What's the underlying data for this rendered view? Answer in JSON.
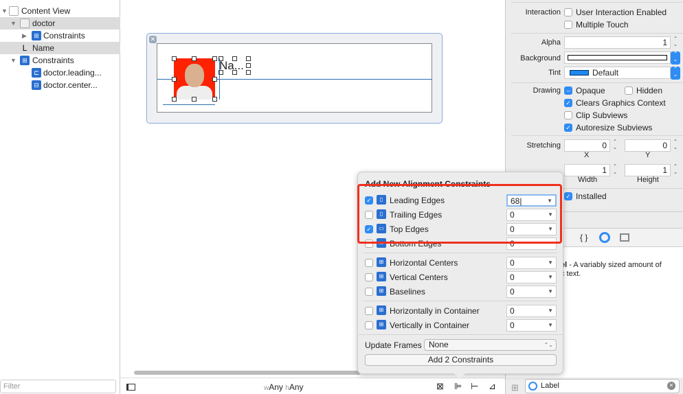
{
  "navigator": {
    "items": [
      {
        "label": "Content View",
        "icon": "view-icon"
      },
      {
        "label": "doctor",
        "icon": "image-view-icon"
      },
      {
        "label": "Constraints",
        "icon": "constraints-icon"
      },
      {
        "label": "Name",
        "icon": "label-icon",
        "glyph": "L"
      },
      {
        "label": "Constraints",
        "icon": "constraints-icon"
      },
      {
        "label": "doctor.leading...",
        "icon": "constraint-icon"
      },
      {
        "label": "doctor.center...",
        "icon": "constraint-icon"
      }
    ],
    "filter_placeholder": "Filter"
  },
  "canvas": {
    "name_label": "Na...",
    "size_class": {
      "w_prefix": "w",
      "w": "Any",
      "h_prefix": "h",
      "h": "Any"
    }
  },
  "inspector": {
    "interaction_label": "Interaction",
    "user_interaction": {
      "label": "User Interaction Enabled",
      "checked": false
    },
    "multiple_touch": {
      "label": "Multiple Touch",
      "checked": false
    },
    "alpha_label": "Alpha",
    "alpha": "1",
    "background_label": "Background",
    "tint_label": "Tint",
    "tint": "Default",
    "tint_color": "#1e88f0",
    "drawing_label": "Drawing",
    "opaque": {
      "label": "Opaque",
      "state": "mixed"
    },
    "hidden": {
      "label": "Hidden",
      "checked": false
    },
    "clears": {
      "label": "Clears Graphics Context",
      "checked": true
    },
    "clip": {
      "label": "Clip Subviews",
      "checked": false
    },
    "autoresize": {
      "label": "Autoresize Subviews",
      "checked": true
    },
    "stretching_label": "Stretching",
    "stretch_x": "0",
    "stretch_y": "0",
    "x_label": "X",
    "y_label": "Y",
    "stretch_w": "1",
    "stretch_h": "1",
    "width_label": "Width",
    "height_label": "Height",
    "installed": {
      "label": "Installed",
      "checked": true
    },
    "library_desc_bold": "el",
    "library_desc": " - A variably sized amount of",
    "library_desc2": "c text.",
    "search_value": "Label"
  },
  "popover": {
    "title": "Add New Alignment Constraints",
    "rows": [
      {
        "label": "Leading Edges",
        "checked": true,
        "value": "68"
      },
      {
        "label": "Trailing Edges",
        "checked": false,
        "value": "0"
      },
      {
        "label": "Top Edges",
        "checked": true,
        "value": "0"
      },
      {
        "label": "Bottom Edges",
        "checked": false,
        "value": "0"
      },
      {
        "label": "Horizontal Centers",
        "checked": false,
        "value": "0"
      },
      {
        "label": "Vertical Centers",
        "checked": false,
        "value": "0"
      },
      {
        "label": "Baselines",
        "checked": false,
        "value": "0"
      },
      {
        "label": "Horizontally in Container",
        "checked": false,
        "value": "0"
      },
      {
        "label": "Vertically in Container",
        "checked": false,
        "value": "0"
      }
    ],
    "update_frames_label": "Update Frames",
    "update_frames_value": "None",
    "add_button": "Add 2 Constraints"
  },
  "colors": {
    "accent": "#2f8cf4",
    "highlight": "#f0301e",
    "constraint": "#2a6fae"
  }
}
